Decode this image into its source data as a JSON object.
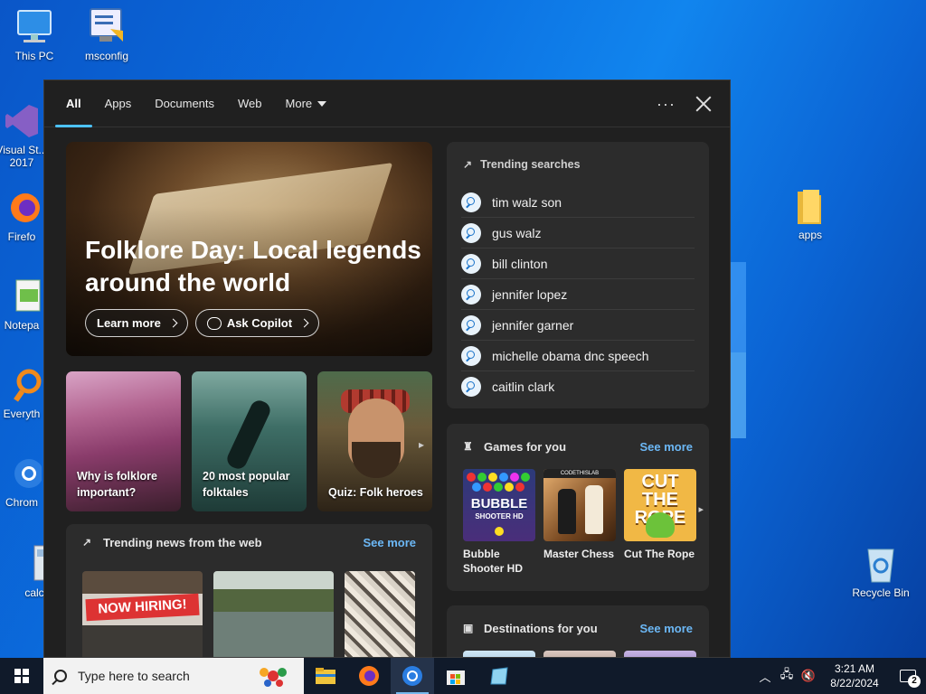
{
  "desktop": {
    "icons": [
      {
        "label": "This PC"
      },
      {
        "label": "msconfig"
      },
      {
        "label": "Visual St... 2017"
      },
      {
        "label": "Firefo"
      },
      {
        "label": "Notepa"
      },
      {
        "label": "Everyth"
      },
      {
        "label": "Chrom"
      },
      {
        "label": "calc"
      },
      {
        "label": "apps"
      },
      {
        "label": "Recycle Bin"
      }
    ]
  },
  "search_panel": {
    "tabs": [
      {
        "label": "All"
      },
      {
        "label": "Apps"
      },
      {
        "label": "Documents"
      },
      {
        "label": "Web"
      },
      {
        "label": "More"
      }
    ],
    "more_menu_label": "···",
    "hero": {
      "title": "Folklore Day: Local legends around the world",
      "learn_more": "Learn more",
      "ask_copilot": "Ask Copilot"
    },
    "cards": [
      {
        "caption": "Why is folklore important?"
      },
      {
        "caption": "20 most popular folktales"
      },
      {
        "caption": "Quiz: Folk heroes"
      }
    ],
    "trending_news": {
      "title": "Trending news from the web",
      "see_more": "See more",
      "thumb1_text": "NOW HIRING!"
    },
    "trending_searches": {
      "title": "Trending searches",
      "items": [
        "tim walz son",
        "gus walz",
        "bill clinton",
        "jennifer lopez",
        "jennifer garner",
        "michelle obama dnc speech",
        "caitlin clark"
      ]
    },
    "games": {
      "title": "Games for you",
      "see_more": "See more",
      "items": [
        {
          "name": "Bubble Shooter HD",
          "art_text": "BUBBLE",
          "art_sub": "SHOOTER HD"
        },
        {
          "name": "Master Chess",
          "art_text": "CODETHISLAB"
        },
        {
          "name": "Cut The Rope",
          "art_text": "CUT THE ROPE"
        }
      ]
    },
    "destinations": {
      "title": "Destinations for you",
      "see_more": "See more"
    }
  },
  "taskbar": {
    "search_placeholder": "Type here to search",
    "clock_time": "3:21 AM",
    "clock_date": "8/22/2024",
    "notification_count": "2"
  }
}
